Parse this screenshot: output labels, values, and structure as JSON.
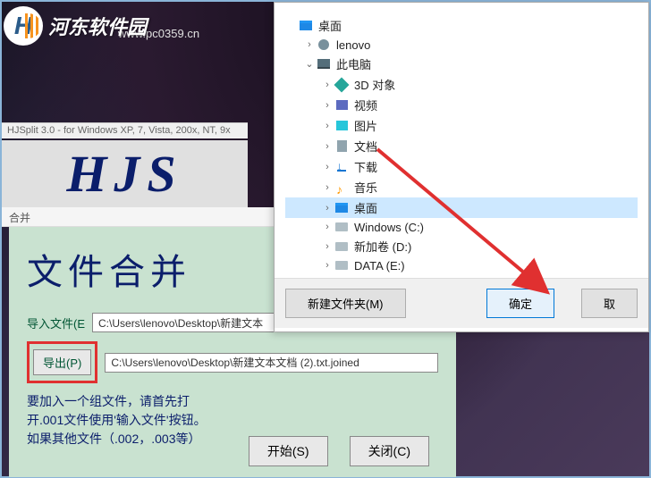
{
  "logo": {
    "text": "河东软件园",
    "url": "www.pc0359.cn"
  },
  "hjsplit": {
    "title": "HJSplit 3.0 - for Windows XP, 7, Vista, 200x, NT, 9x",
    "logo_text": "HJS"
  },
  "merge": {
    "window_title": "合并",
    "heading": "文件合并",
    "input_label": "导入文件(E",
    "input_path": "C:\\Users\\lenovo\\Desktop\\新建文本",
    "export_btn": "导出(P)",
    "output_path": "C:\\Users\\lenovo\\Desktop\\新建文本文档 (2).txt.joined",
    "help_line1": "要加入一个组文件，请首先打",
    "help_line2": "开.001文件使用'输入文件'按钮。",
    "help_line3": "如果其他文件（.002，.003等）",
    "start_btn": "开始(S)",
    "close_btn": "关闭(C)"
  },
  "browse": {
    "root": "桌面",
    "user": "lenovo",
    "pc": "此电脑",
    "items": {
      "obj3d": "3D 对象",
      "video": "视频",
      "pictures": "图片",
      "documents": "文档",
      "downloads": "下载",
      "music": "音乐",
      "desktop": "桌面",
      "c_drive": "Windows (C:)",
      "d_drive": "新加卷 (D:)",
      "e_drive": "DATA (E:)"
    },
    "new_folder_btn": "新建文件夹(M)",
    "ok_btn": "确定",
    "cancel_btn": "取"
  }
}
